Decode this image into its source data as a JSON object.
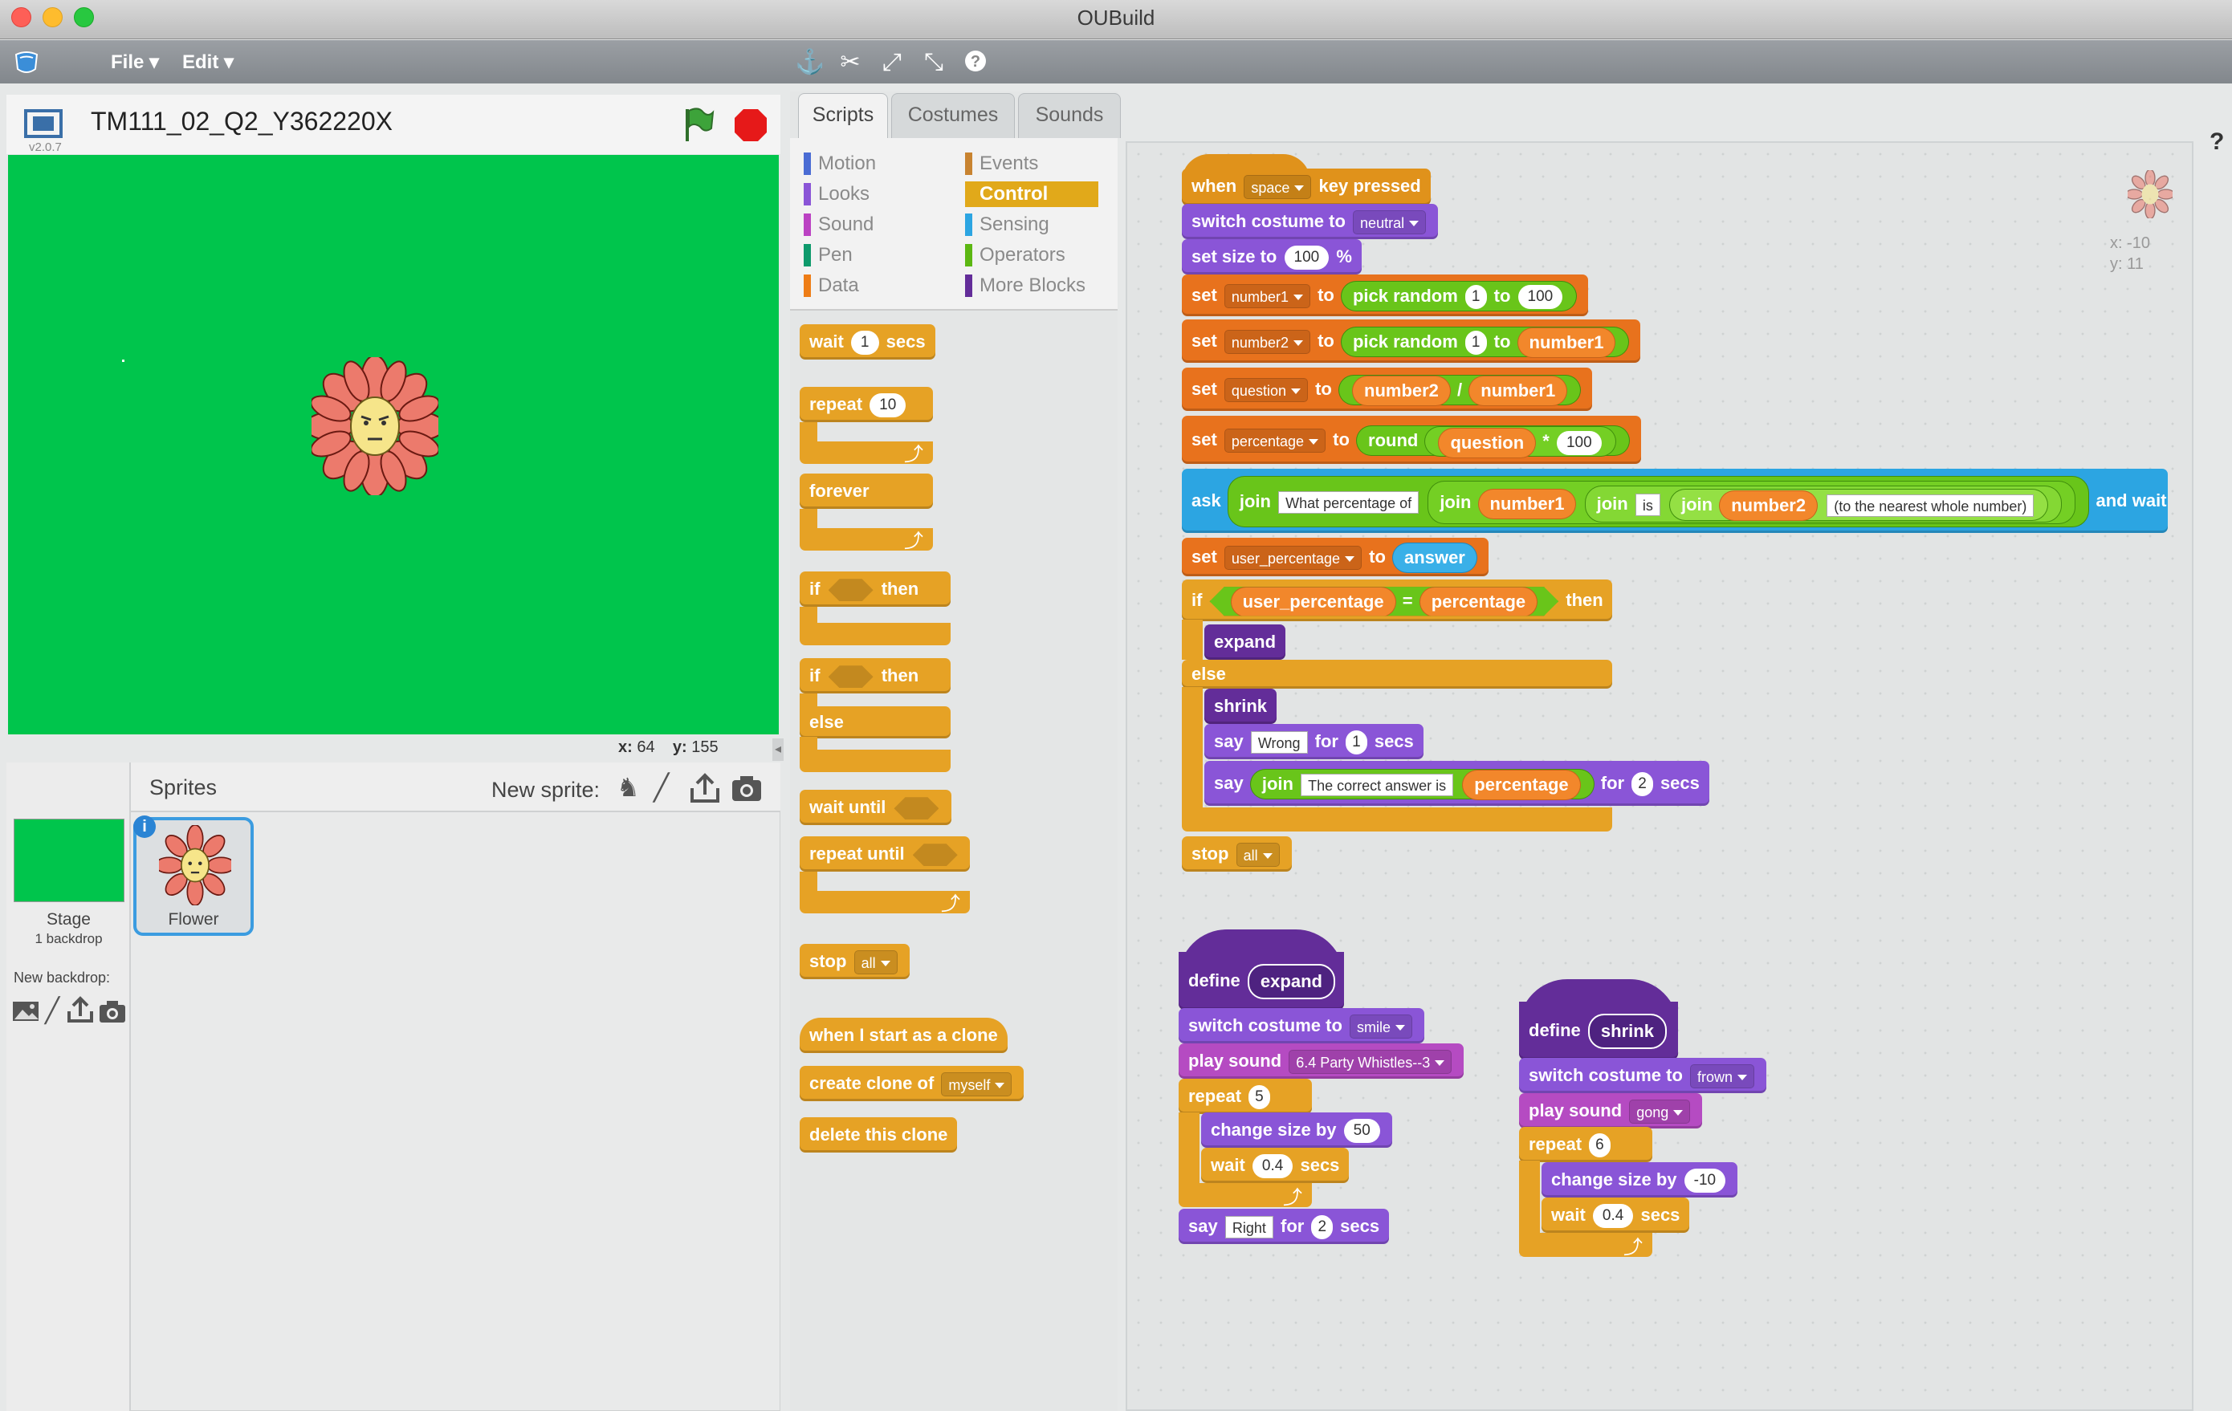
{
  "window": {
    "title": "OUBuild"
  },
  "menu": {
    "file": "File",
    "edit": "Edit"
  },
  "stage": {
    "project_title": "TM111_02_Q2_Y362220X",
    "version": "v2.0.7",
    "x_label": "x:",
    "x_value": "64",
    "y_label": "y:",
    "y_value": "155"
  },
  "sprites": {
    "header": "Sprites",
    "new_sprite": "New sprite:",
    "stage_label": "Stage",
    "stage_backdrops": "1 backdrop",
    "new_backdrop": "New backdrop:",
    "sprite_name": "Flower",
    "info_badge": "i"
  },
  "tabs": [
    "Scripts",
    "Costumes",
    "Sounds"
  ],
  "categories": {
    "motion": "Motion",
    "looks": "Looks",
    "sound": "Sound",
    "pen": "Pen",
    "data": "Data",
    "events": "Events",
    "control": "Control",
    "sensing": "Sensing",
    "operators": "Operators",
    "more": "More Blocks"
  },
  "colors": {
    "motion": "#4a6cd4",
    "looks": "#8a55d7",
    "sound": "#bb42c3",
    "pen": "#0e9a6c",
    "data": "#ee7d16",
    "events": "#c88330",
    "control": "#e1a91a",
    "sensing": "#2ca5e2",
    "operators": "#5cb712",
    "more": "#632d99",
    "stage": "#00c54c"
  },
  "palette": {
    "wait": "wait",
    "wait_val": "1",
    "secs": "secs",
    "repeat": "repeat",
    "repeat_val": "10",
    "forever": "forever",
    "if": "if",
    "then": "then",
    "else": "else",
    "wait_until": "wait until",
    "repeat_until": "repeat until",
    "stop": "stop",
    "stop_val": "all",
    "when_clone": "when I start as a clone",
    "create_clone": "create clone of",
    "create_clone_val": "myself",
    "delete_clone": "delete this clone"
  },
  "sprite_info": {
    "x": "x: -10",
    "y": "y: 11"
  },
  "script1": {
    "when": "when",
    "key": "space",
    "key_pressed": "key pressed",
    "switch_costume": "switch costume to",
    "costume1": "neutral",
    "set_size": "set size to",
    "size_val": "100",
    "percent": "%",
    "set": "set",
    "to": "to",
    "var1": "number1",
    "pick_random": "pick random",
    "r1_from": "1",
    "r1_to": "100",
    "var2": "number2",
    "r2_from": "1",
    "r2_to": "number1",
    "var3": "question",
    "div_a": "number2",
    "div_op": "/",
    "div_b": "number1",
    "var4": "percentage",
    "round": "round",
    "round_a": "question",
    "mul_op": "*",
    "mul_b": "100",
    "ask": "ask",
    "join": "join",
    "j1": "What percentage of",
    "j2": "number1",
    "j3": "is",
    "j4": "number2",
    "j5": "(to the nearest whole number)",
    "and_wait": "and wait",
    "var5": "user_percentage",
    "answer": "answer",
    "if": "if",
    "eq_a": "user_percentage",
    "eq_op": "=",
    "eq_b": "percentage",
    "then": "then",
    "expand": "expand",
    "else": "else",
    "shrink": "shrink",
    "say": "say",
    "wrong": "Wrong",
    "for": "for",
    "say1_secs": "1",
    "secs": "secs",
    "correct": "The correct answer is",
    "say2_var": "percentage",
    "say2_secs": "2",
    "stop": "stop",
    "stop_val": "all"
  },
  "script2": {
    "define": "define",
    "name": "expand",
    "switch_costume": "switch costume to",
    "costume": "smile",
    "play_sound": "play sound",
    "sound": "6.4 Party Whistles--3",
    "repeat": "repeat",
    "repeat_val": "5",
    "change_size": "change size by",
    "change_val": "50",
    "wait": "wait",
    "wait_val": "0.4",
    "secs": "secs",
    "say": "say",
    "say_val": "Right",
    "for": "for",
    "say_secs": "2"
  },
  "script3": {
    "define": "define",
    "name": "shrink",
    "switch_costume": "switch costume to",
    "costume": "frown",
    "play_sound": "play sound",
    "sound": "gong",
    "repeat": "repeat",
    "repeat_val": "6",
    "change_size": "change size by",
    "change_val": "-10",
    "wait": "wait",
    "wait_val": "0.4",
    "secs": "secs"
  }
}
